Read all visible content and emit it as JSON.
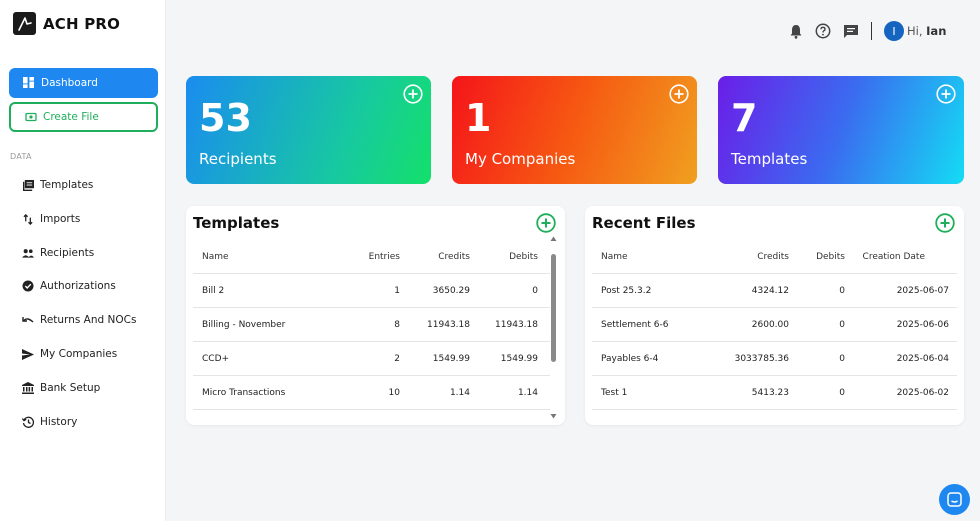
{
  "app": {
    "name": "ACH PRO"
  },
  "sidebar": {
    "dashboard_label": "Dashboard",
    "create_label": "Create File",
    "section_label": "DATA",
    "items": [
      {
        "label": "Templates",
        "icon": "templates-icon"
      },
      {
        "label": "Imports",
        "icon": "imports-icon"
      },
      {
        "label": "Recipients",
        "icon": "recipients-icon"
      },
      {
        "label": "Authorizations",
        "icon": "verified-icon"
      },
      {
        "label": "Returns And NOCs",
        "icon": "undo-icon"
      },
      {
        "label": "My Companies",
        "icon": "send-icon"
      },
      {
        "label": "Bank Setup",
        "icon": "bank-icon"
      },
      {
        "label": "History",
        "icon": "history-icon"
      }
    ]
  },
  "topbar": {
    "avatar_initial": "I",
    "greeting_prefix": "Hi,",
    "user_name": "Ian"
  },
  "stats": [
    {
      "value": "53",
      "label": "Recipients"
    },
    {
      "value": "1",
      "label": "My Companies"
    },
    {
      "value": "7",
      "label": "Templates"
    }
  ],
  "templates_panel": {
    "title": "Templates",
    "columns": [
      "Name",
      "Entries",
      "Credits",
      "Debits"
    ],
    "rows": [
      [
        "Bill 2",
        "1",
        "3650.29",
        "0"
      ],
      [
        "Billing - November",
        "8",
        "11943.18",
        "11943.18"
      ],
      [
        "CCD+",
        "2",
        "1549.99",
        "1549.99"
      ],
      [
        "Micro Transactions",
        "10",
        "1.14",
        "1.14"
      ]
    ]
  },
  "recent_panel": {
    "title": "Recent Files",
    "columns": [
      "Name",
      "Credits",
      "Debits",
      "Creation Date"
    ],
    "rows": [
      [
        "Post 25.3.2",
        "4324.12",
        "0",
        "2025-06-07"
      ],
      [
        "Settlement 6-6",
        "2600.00",
        "0",
        "2025-06-06"
      ],
      [
        "Payables 6-4",
        "3033785.36",
        "0",
        "2025-06-04"
      ],
      [
        "Test 1",
        "5413.23",
        "0",
        "2025-06-02"
      ]
    ]
  },
  "colors": {
    "primary": "#1e88f0",
    "success": "#1fae5b"
  }
}
